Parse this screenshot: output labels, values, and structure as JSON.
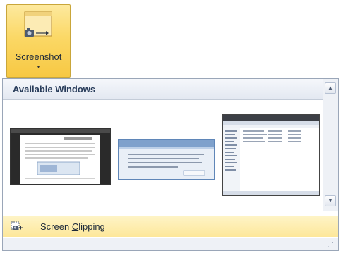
{
  "ribbon": {
    "screenshot_label": "Screenshot",
    "dropdown_arrow": "▾"
  },
  "dropdown": {
    "section_header": "Available Windows",
    "thumbnail_count": 3,
    "scroll_up_glyph": "▲",
    "scroll_down_glyph": "▼",
    "clipping": {
      "label_before": "Screen ",
      "access_key": "C",
      "label_after": "lipping"
    },
    "grip_glyph": "⋰"
  },
  "colors": {
    "ribbon_highlight": "#f9d461",
    "section_header_text": "#283c5a",
    "menu_highlight": "#fde79a"
  }
}
